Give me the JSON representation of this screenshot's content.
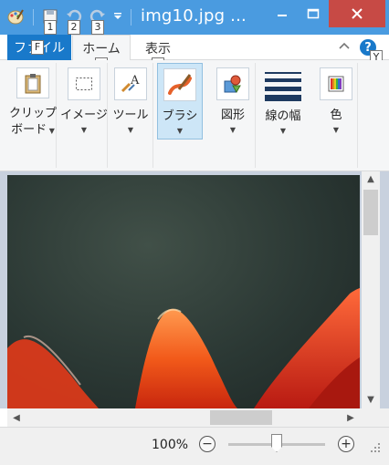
{
  "window": {
    "title": "img10.jpg ...",
    "accent": "#4a9be0",
    "close_color": "#c74a45"
  },
  "quick_access": {
    "items": [
      {
        "name": "app-menu-icon"
      },
      {
        "name": "save-icon",
        "keytip": "1"
      },
      {
        "name": "undo-icon",
        "keytip": "2"
      },
      {
        "name": "redo-icon",
        "keytip": "3"
      },
      {
        "name": "customize-icon"
      }
    ]
  },
  "tabs": {
    "file": {
      "label": "ファイル",
      "keytip": "F"
    },
    "home": {
      "label": "ホーム",
      "keytip": "H"
    },
    "view": {
      "label": "表示",
      "keytip": "V"
    },
    "help_keytip": "Y",
    "help_label": "?"
  },
  "ribbon": {
    "clipboard": {
      "label1": "クリップ",
      "label2": "ボード"
    },
    "image": {
      "label": "イメージ"
    },
    "tools": {
      "label": "ツール"
    },
    "brushes": {
      "label": "ブラシ"
    },
    "shapes": {
      "label": "図形"
    },
    "size": {
      "label": "線の幅"
    },
    "colors": {
      "label": "色"
    }
  },
  "status": {
    "zoom": "100%",
    "zoom_out": "−",
    "zoom_in": "+"
  }
}
